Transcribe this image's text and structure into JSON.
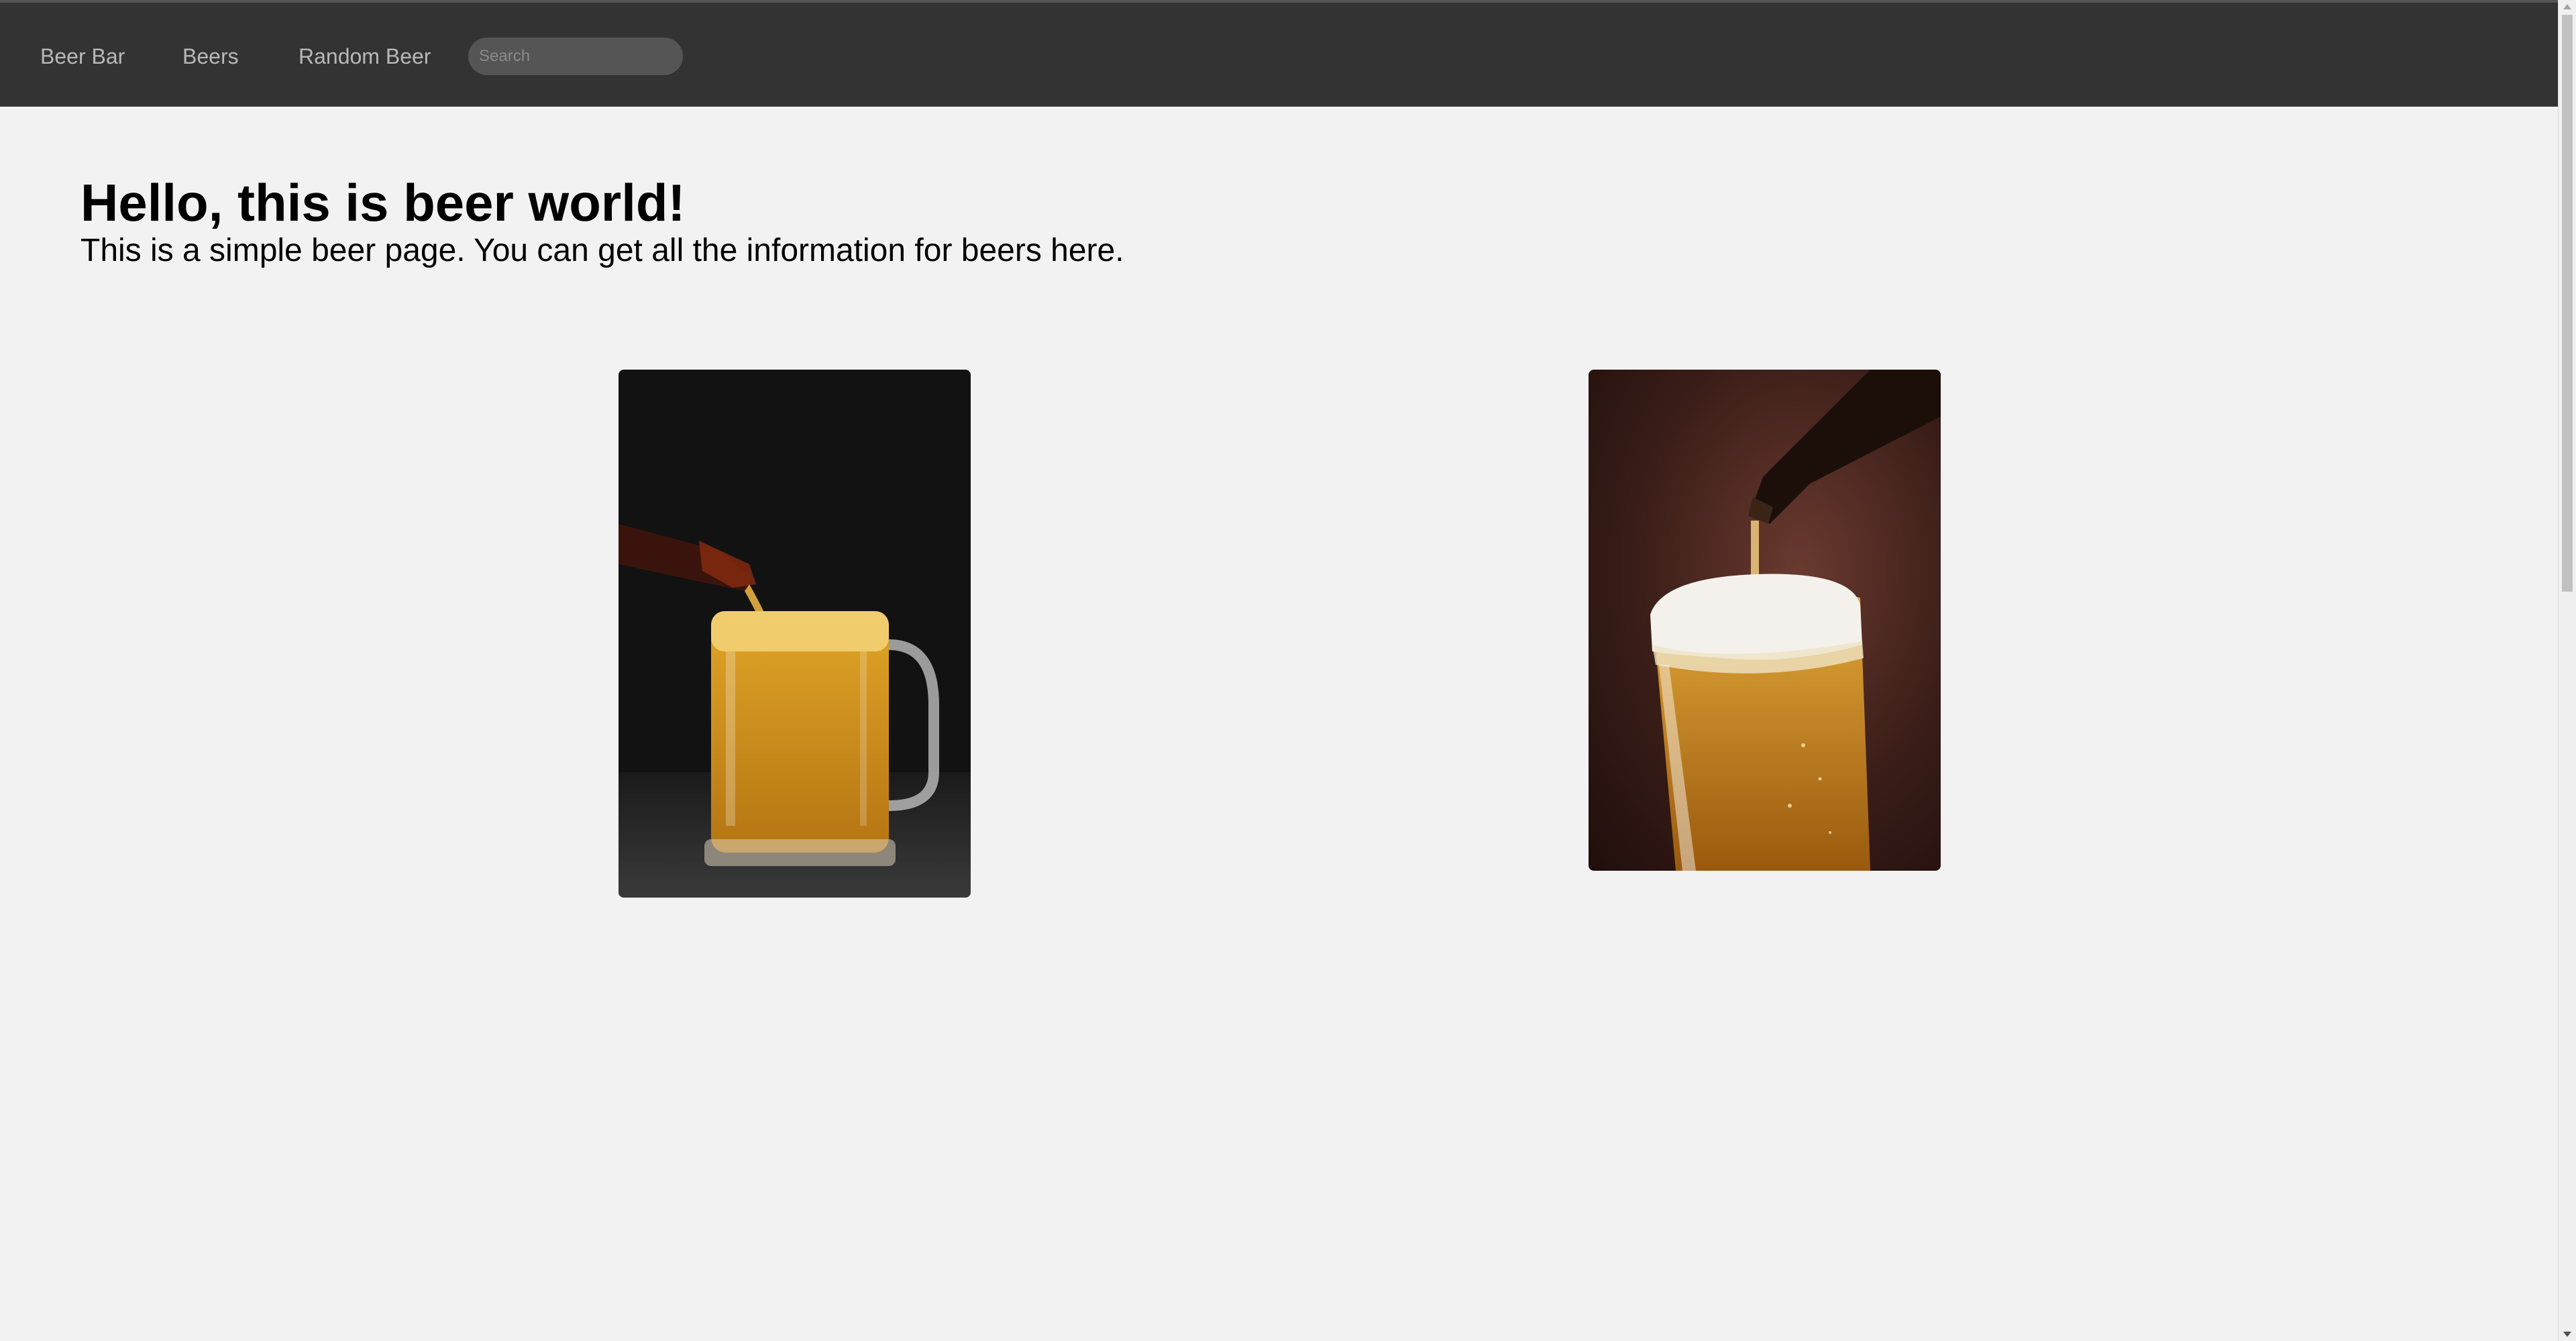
{
  "nav": {
    "brand": "Beer Bar",
    "beers": "Beers",
    "random": "Random Beer",
    "search_placeholder": "Search"
  },
  "hero": {
    "title": "Hello, this is beer world!",
    "subtitle": "This is a simple beer page. You can get all the information for beers here."
  },
  "photos": [
    {
      "icon": "beer-mug-pour-photo"
    },
    {
      "icon": "beer-glass-pour-photo"
    }
  ],
  "colors": {
    "navbar": "#333333",
    "nav_link": "#b8b8b8",
    "page_bg": "#f2f2f2",
    "beer": "#d99a1f"
  }
}
